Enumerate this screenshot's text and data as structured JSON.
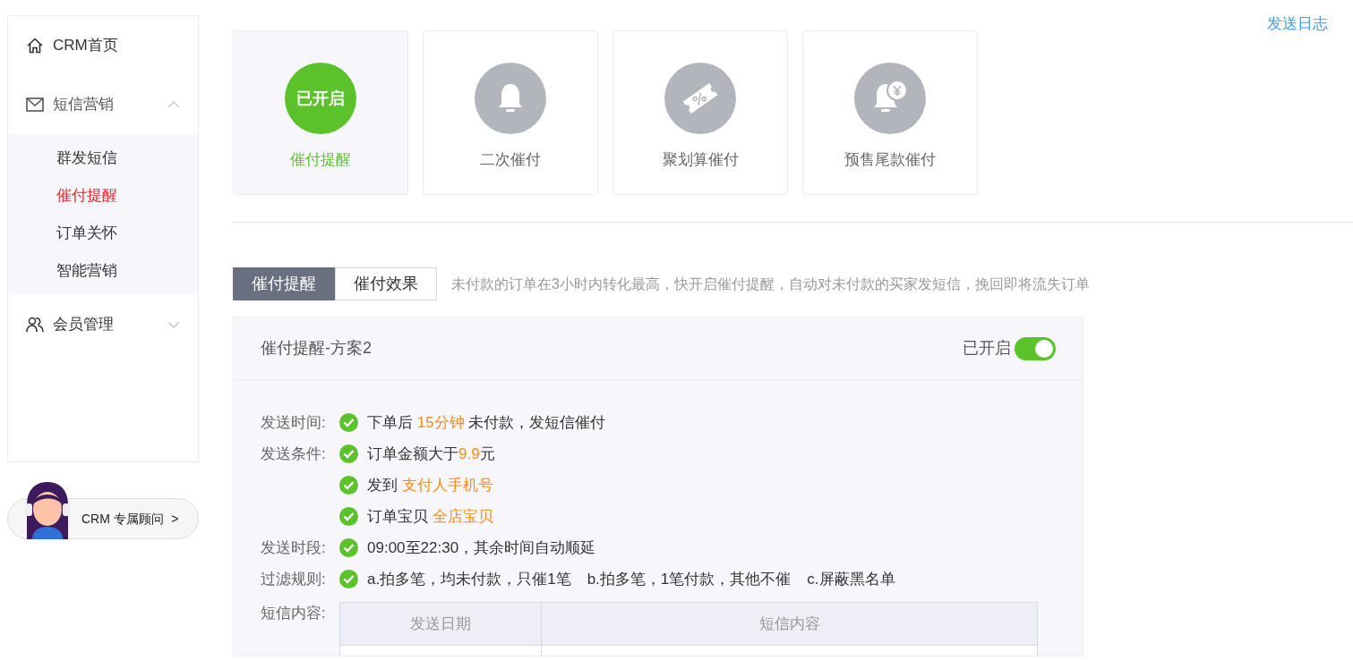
{
  "sidebar": {
    "items": [
      {
        "label": "CRM首页",
        "kind": "home"
      },
      {
        "label": "短信营销",
        "kind": "mail",
        "expanded": true,
        "children": [
          {
            "label": "群发短信",
            "selected": false
          },
          {
            "label": "催付提醒",
            "selected": true
          },
          {
            "label": "订单关怀",
            "selected": false
          },
          {
            "label": "智能营销",
            "selected": false
          }
        ]
      },
      {
        "label": "会员管理",
        "kind": "users",
        "expanded": false
      }
    ]
  },
  "advisor": {
    "label": "CRM 专属顾问",
    "arrow": ">"
  },
  "log_link": "发送日志",
  "scenes": [
    {
      "label": "催付提醒",
      "selected": true,
      "on": true,
      "badge": "已开启"
    },
    {
      "label": "二次催付",
      "selected": false,
      "on": false,
      "kind": "bell"
    },
    {
      "label": "聚划算催付",
      "selected": false,
      "on": false,
      "kind": "ticket"
    },
    {
      "label": "预售尾款催付",
      "selected": false,
      "on": false,
      "kind": "coin"
    }
  ],
  "tabs": [
    {
      "label": "催付提醒",
      "selected": true
    },
    {
      "label": "催付效果",
      "selected": false
    }
  ],
  "tip": "未付款的订单在3小时内转化最高，快开启催付提醒，自动对未付款的买家发短信，挽回即将流失订单",
  "plan": {
    "title": "催付提醒-方案2",
    "status": "已开启",
    "on": true,
    "rules": [
      {
        "label": "发送时间:",
        "parts": [
          [
            {
              "text": "下单后 "
            },
            {
              "text": "15分钟",
              "highlight": true
            },
            {
              "text": " 未付款，发短信催付"
            }
          ]
        ]
      },
      {
        "label": "发送条件:",
        "parts": [
          [
            {
              "text": "订单金额大于"
            },
            {
              "text": "9.9",
              "highlight": true
            },
            {
              "text": "元"
            }
          ]
        ]
      },
      {
        "parts": [
          [
            {
              "text": "发到 "
            },
            {
              "text": "支付人手机号",
              "highlight": true
            }
          ]
        ]
      },
      {
        "parts": [
          [
            {
              "text": "订单宝贝 "
            },
            {
              "text": "全店宝贝",
              "highlight": true
            }
          ]
        ]
      },
      {
        "label": "发送时段:",
        "parts": [
          [
            {
              "text": "09:00至22:30，其余时间自动顺延"
            }
          ]
        ]
      },
      {
        "label": "过滤规则:",
        "parts": [
          [
            {
              "text": "a.拍多笔，均未付款，只催1笔"
            }
          ],
          [
            {
              "text": "b.拍多笔，1笔付款，其他不催"
            }
          ],
          [
            {
              "text": "c.屏蔽黑名单"
            }
          ]
        ]
      }
    ],
    "content_label": "短信内容:",
    "table": {
      "columns": [
        "发送日期",
        "短信内容"
      ]
    }
  }
}
